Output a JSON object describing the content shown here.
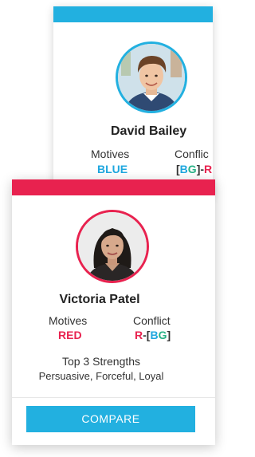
{
  "colors": {
    "blue": "#22b0e0",
    "red": "#e8224f",
    "green": "#29b287"
  },
  "back_card": {
    "name": "David Bailey",
    "motives_label": "Motives",
    "motives_value": "BLUE",
    "conflict_label": "Conflic",
    "conflict_value": {
      "open_bracket": "[",
      "b": "B",
      "g": "G",
      "close_bracket": "]",
      "dash": "-",
      "tail": "R"
    },
    "avatar_icon": "person-photo-icon"
  },
  "front_card": {
    "name": "Victoria Patel",
    "motives_label": "Motives",
    "motives_value": "RED",
    "conflict_label": "Conflict",
    "conflict_value": {
      "r": "R",
      "dash": "-",
      "open_bracket": "[",
      "b": "B",
      "g": "G",
      "close_bracket": "]"
    },
    "strengths_title": "Top 3 Strengths",
    "strengths_value": "Persuasive, Forceful, Loyal",
    "compare_label": "COMPARE",
    "avatar_icon": "person-photo-icon"
  }
}
